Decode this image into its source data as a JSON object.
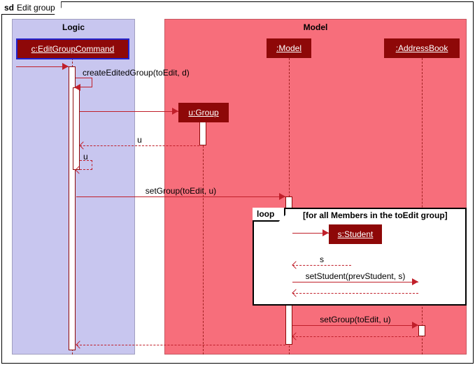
{
  "frame": {
    "prefix": "sd",
    "title": "Edit group"
  },
  "regions": {
    "logic": "Logic",
    "model": "Model"
  },
  "participants": {
    "c": "c:EditGroupCommand",
    "u": "u:Group",
    "model": ":Model",
    "ab": ":AddressBook",
    "s": "s:Student"
  },
  "messages": {
    "createEditedGroup": "createEditedGroup(toEdit, d)",
    "return_u_1": "u",
    "return_u_2": "u",
    "setGroup1": "setGroup(toEdit, u)",
    "return_s": "s",
    "setStudent": "setStudent(prevStudent, s)",
    "setGroup2": "setGroup(toEdit, u)"
  },
  "loop": {
    "label": "loop",
    "guard": "[for all Members in the toEdit group]"
  },
  "chart_data": {
    "type": "table",
    "diagram": "UML sequence diagram (sd)",
    "title": "Edit group",
    "regions": [
      {
        "name": "Logic",
        "participants": [
          "c:EditGroupCommand"
        ]
      },
      {
        "name": "Model",
        "participants": [
          "u:Group",
          ":Model",
          ":AddressBook",
          "s:Student"
        ]
      }
    ],
    "interactions": [
      {
        "from": "(caller)",
        "to": "c:EditGroupCommand",
        "kind": "call",
        "activates": "c"
      },
      {
        "from": "c:EditGroupCommand",
        "to": "c:EditGroupCommand",
        "kind": "self-call",
        "message": "createEditedGroup(toEdit, d)"
      },
      {
        "from": "c:EditGroupCommand",
        "to": "u:Group",
        "kind": "create",
        "creates": "u:Group"
      },
      {
        "from": "u:Group",
        "to": "c:EditGroupCommand",
        "kind": "return",
        "message": "u"
      },
      {
        "from": "c:EditGroupCommand",
        "to": "c:EditGroupCommand",
        "kind": "self-return",
        "message": "u"
      },
      {
        "from": "c:EditGroupCommand",
        "to": ":Model",
        "kind": "call",
        "message": "setGroup(toEdit, u)"
      },
      {
        "fragment": "loop",
        "guard": "[for all Members in the toEdit group]",
        "body": [
          {
            "from": ":Model",
            "to": "s:Student",
            "kind": "create",
            "creates": "s:Student"
          },
          {
            "from": "s:Student",
            "to": ":Model",
            "kind": "return",
            "message": "s"
          },
          {
            "from": ":Model",
            "to": ":AddressBook",
            "kind": "call",
            "message": "setStudent(prevStudent, s)"
          },
          {
            "from": ":AddressBook",
            "to": ":Model",
            "kind": "return"
          }
        ]
      },
      {
        "from": ":Model",
        "to": ":AddressBook",
        "kind": "call",
        "message": "setGroup(toEdit, u)"
      },
      {
        "from": ":AddressBook",
        "to": ":Model",
        "kind": "return"
      },
      {
        "from": ":Model",
        "to": "c:EditGroupCommand",
        "kind": "return"
      }
    ]
  }
}
